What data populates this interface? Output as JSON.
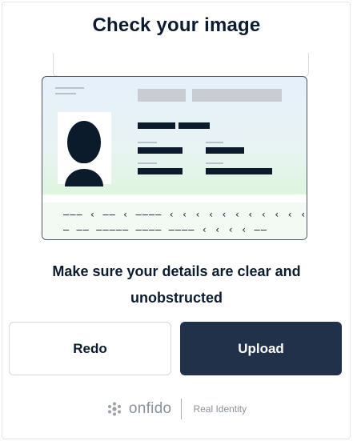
{
  "header": {
    "title": "Check your image"
  },
  "card": {
    "mrz_line_1": "——— ‹ —— ‹ ———— ‹ ‹ ‹ ‹ ‹ ‹ ‹ ‹ ‹ ‹ ‹ ‹ ‹ ‹ ‹",
    "mrz_line_2": "— —— ————— ———— ———— ‹ ‹ ‹ ‹ ——"
  },
  "instruction": "Make sure your details are clear and unobstructed",
  "buttons": {
    "redo_label": "Redo",
    "upload_label": "Upload"
  },
  "footer": {
    "brand": "onfido",
    "tagline": "Real Identity"
  },
  "colors": {
    "primary": "#22314a",
    "text": "#0d1b2e",
    "muted": "#8a9199"
  }
}
